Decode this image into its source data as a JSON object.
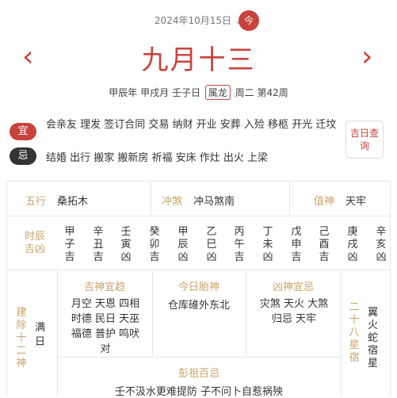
{
  "header": {
    "gregorian_date": "2024年10月15日",
    "today_label": "今",
    "prev_arrow": "‹",
    "next_arrow": "›",
    "lunar_date": "九月十三",
    "year_gz": "甲辰年",
    "month_gz": "甲戌月",
    "day_gz": "壬子日",
    "zodiac": "属龙",
    "weekday": "周二",
    "week_no": "第42周"
  },
  "yi": {
    "label": "宜",
    "text": "会亲友 理发 签订合同 交易 纳财 开业 安葬 入殓 移柩 开光 迁坟"
  },
  "ji": {
    "label": "忌",
    "text": "结婚 出行 搬家 搬新房 祈福 安床 作灶 出火 上梁"
  },
  "jiri_button": "吉日查询",
  "info": {
    "wuxing_label": "五行",
    "wuxing_value": "桑拓木",
    "chongsha_label": "冲煞",
    "chongsha_value": "冲马煞南",
    "zhishen_label": "值神",
    "zhishen_value": "天牢"
  },
  "hours": {
    "label": "时辰吉凶",
    "items": [
      {
        "gz": "甲子",
        "luck": "吉"
      },
      {
        "gz": "辛丑",
        "luck": "吉"
      },
      {
        "gz": "壬寅",
        "luck": "凶"
      },
      {
        "gz": "癸卯",
        "luck": "吉"
      },
      {
        "gz": "甲辰",
        "luck": "凶"
      },
      {
        "gz": "乙巳",
        "luck": "凶"
      },
      {
        "gz": "丙午",
        "luck": "吉"
      },
      {
        "gz": "丁未",
        "luck": "凶"
      },
      {
        "gz": "戊申",
        "luck": "吉"
      },
      {
        "gz": "己酉",
        "luck": "吉"
      },
      {
        "gz": "庚戌",
        "luck": "凶"
      },
      {
        "gz": "辛亥",
        "luck": "凶"
      }
    ]
  },
  "jianchu": {
    "label": "建除十二神",
    "value": "满日"
  },
  "jishen": {
    "title": "吉神宜趋",
    "text": "月空 天恩 四相 时德 民日 天巫 福德 普护 鸣吠 对"
  },
  "taishen": {
    "title": "今日胎神",
    "text": "仓库碓外东北"
  },
  "xiongsha": {
    "title": "凶神宜忌",
    "text": "灾煞 天火 大煞 归忌 天牢"
  },
  "xiu": {
    "label": "二十八星宿",
    "value": "翼火蛇宿星"
  },
  "pengzu": {
    "title": "彭祖百忌",
    "text": "壬不汲水更难提防 子不问卜自惹祸殃"
  }
}
